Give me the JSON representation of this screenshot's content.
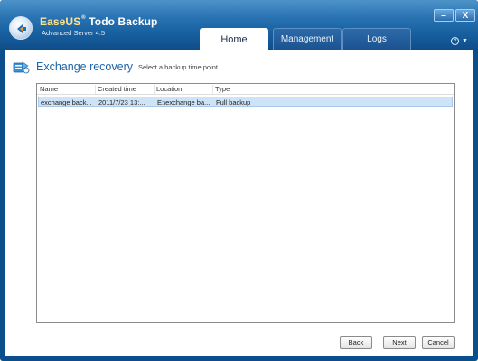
{
  "app": {
    "brand_prefix": "EaseUS",
    "brand_mark": "®",
    "brand_name": "Todo Backup",
    "edition": "Advanced Server 4.5"
  },
  "window_controls": {
    "minimize": "–",
    "close": "X"
  },
  "help": {
    "icon": "?",
    "caret": "▼"
  },
  "tabs": [
    {
      "label": "Home",
      "active": true
    },
    {
      "label": "Management",
      "active": false
    },
    {
      "label": "Logs",
      "active": false
    }
  ],
  "page": {
    "title": "Exchange recovery",
    "subtitle": "Select a backup time point"
  },
  "table": {
    "columns": [
      "Name",
      "Created time",
      "Location",
      "Type"
    ],
    "rows": [
      {
        "name": "exchange back...",
        "created": "2011/7/23 13:...",
        "location": "E:\\exchange ba...",
        "type": "Full backup",
        "selected": true
      }
    ]
  },
  "buttons": {
    "back": "Back",
    "next": "Next",
    "cancel": "Cancel"
  },
  "colors": {
    "title_blue": "#1d64a8",
    "selection": "#cfe3f6",
    "titlebar": "#2a74b3",
    "frame": "#0a4f8c"
  },
  "icons": {
    "logo": "easeus-logo-icon",
    "header": "exchange-recovery-icon",
    "help": "help-icon"
  }
}
